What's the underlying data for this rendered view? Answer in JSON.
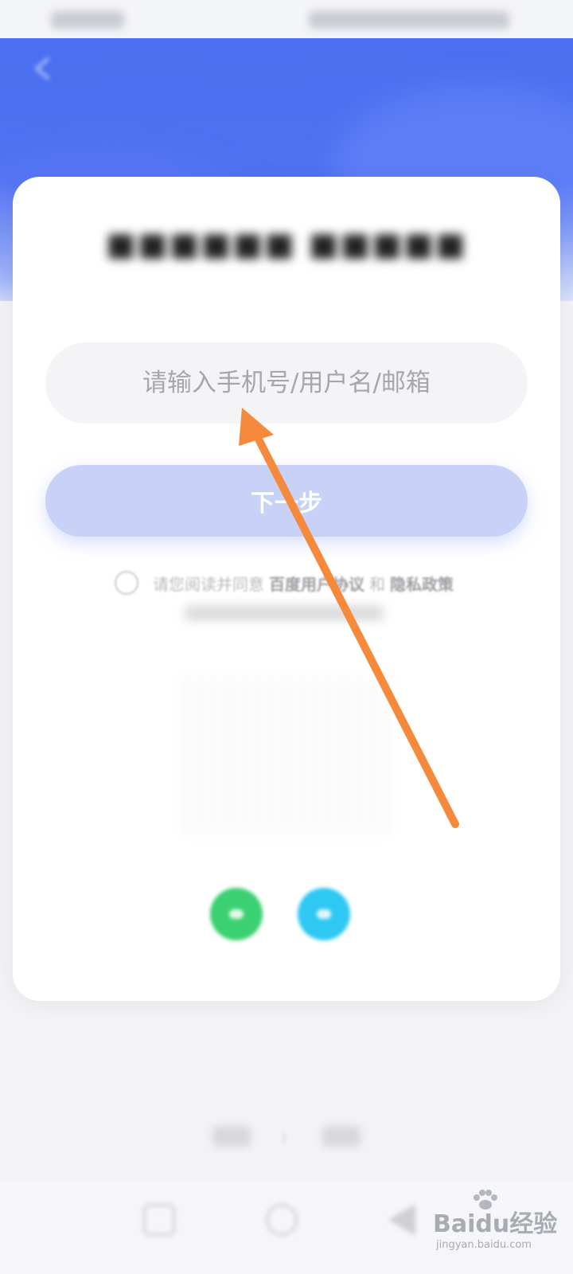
{
  "login": {
    "account_placeholder": "请输入手机号/用户名/邮箱",
    "next_label": "下一步"
  },
  "agreement": {
    "prefix": "请您阅读并同意",
    "user_agreement": "百度用户协议",
    "conjunction": "和",
    "privacy_policy": "隐私政策"
  },
  "watermark": {
    "logo": "Baidu经验",
    "url": "jingyan.baidu.com"
  },
  "colors": {
    "header_blue": "#4a6ff0",
    "next_button": "#c8d2f7",
    "annotation_arrow": "#f58a3c",
    "wechat_green": "#3bd071",
    "qq_blue": "#2ec8f2"
  },
  "icons": {
    "back": "chevron-left-icon",
    "wechat": "wechat-icon",
    "qq": "qq-icon",
    "nav_recent": "square-icon",
    "nav_home": "circle-icon",
    "nav_back": "triangle-icon"
  }
}
